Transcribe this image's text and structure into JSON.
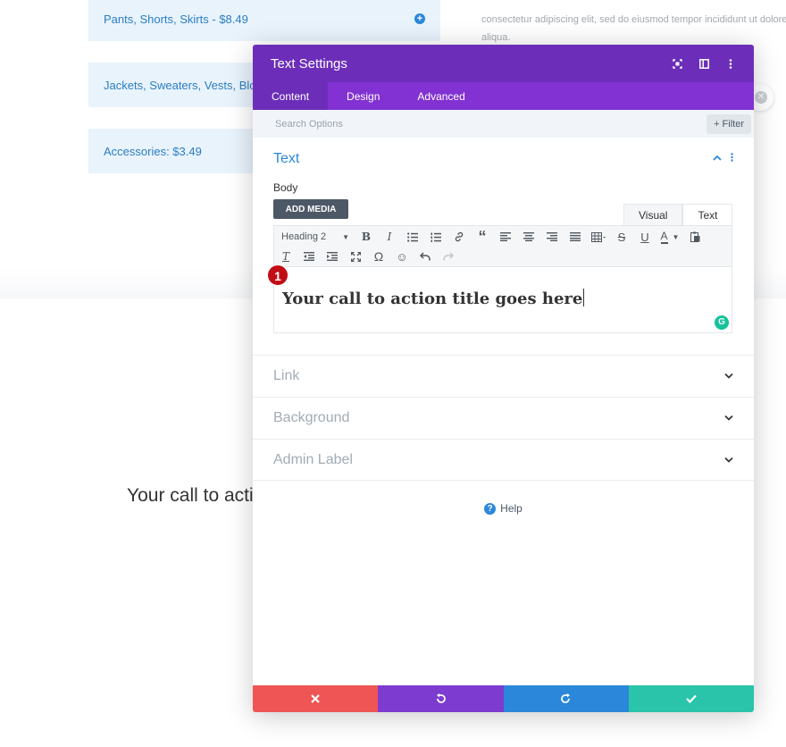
{
  "background": {
    "price_boxes": [
      "Pants, Shorts, Skirts - $8.49",
      "Jackets, Sweaters, Vests, Blou",
      "Accessories: $3.49"
    ],
    "lorem_line1": "consectetur adipiscing elit, sed do eiusmod tempor incididunt ut dolore",
    "lorem_line2": "aliqua.",
    "cta_text": "Your call to acti"
  },
  "modal": {
    "title": "Text Settings",
    "header_icons": [
      "focus-icon",
      "split-view-icon",
      "more-vertical-icon"
    ],
    "tabs": [
      {
        "label": "Content",
        "active": true
      },
      {
        "label": "Design",
        "active": false
      },
      {
        "label": "Advanced",
        "active": false
      }
    ],
    "search_placeholder": "Search Options",
    "filter_label": "Filter",
    "text_section": {
      "title": "Text",
      "body_label": "Body",
      "add_media_label": "ADD MEDIA",
      "visual_tab": "Visual",
      "text_tab": "Text",
      "format_select": "Heading 2",
      "editor_content": "Your call to action title goes here",
      "step_badge": "1"
    },
    "collapsed_sections": [
      "Link",
      "Background",
      "Admin Label"
    ],
    "help_label": "Help",
    "footer_colors": {
      "cancel": "#ef5555",
      "undo": "#7e3bd0",
      "redo": "#2b87da",
      "save": "#29c4a9"
    }
  }
}
